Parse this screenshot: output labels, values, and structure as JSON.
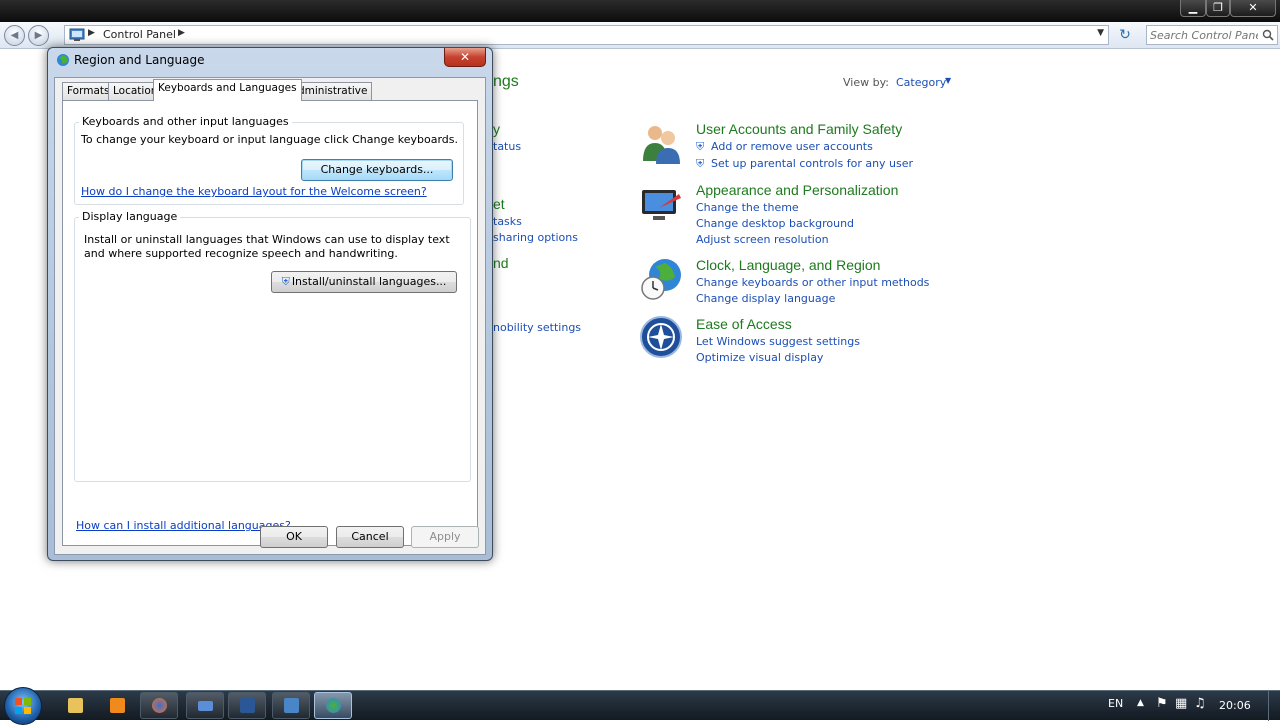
{
  "explorer": {
    "breadcrumb": "Control Panel",
    "search_placeholder": "Search Control Panel",
    "view_by_label": "View by:",
    "view_by_value": "Category",
    "partial_heading": "ngs",
    "partial_items": [
      "y",
      "tatus",
      "et",
      "tasks",
      "sharing options",
      "nd",
      "nobility settings"
    ],
    "categories": [
      {
        "title": "User Accounts and Family Safety",
        "links": [
          "Add or remove user accounts",
          "Set up parental controls for any user"
        ]
      },
      {
        "title": "Appearance and Personalization",
        "links": [
          "Change the theme",
          "Change desktop background",
          "Adjust screen resolution"
        ]
      },
      {
        "title": "Clock, Language, and Region",
        "links": [
          "Change keyboards or other input methods",
          "Change display language"
        ]
      },
      {
        "title": "Ease of Access",
        "links": [
          "Let Windows suggest settings",
          "Optimize visual display"
        ]
      }
    ]
  },
  "dialog": {
    "title": "Region and Language",
    "close_label": "✕",
    "tabs": [
      "Formats",
      "Location",
      "Keyboards and Languages",
      "Administrative"
    ],
    "active_tab": "Keyboards and Languages",
    "keyboards_group": {
      "label": "Keyboards and other input languages",
      "text": "To change your keyboard or input language click Change keyboards.",
      "button": "Change keyboards...",
      "link": "How do I change the keyboard layout for the Welcome screen?"
    },
    "display_group": {
      "label": "Display language",
      "text": "Install or uninstall languages that Windows can use to display text and where supported recognize speech and handwriting.",
      "button": "Install/uninstall languages..."
    },
    "bottom_link": "How can I install additional languages?",
    "buttons": {
      "ok": "OK",
      "cancel": "Cancel",
      "apply": "Apply"
    }
  },
  "taskbar": {
    "language": "EN",
    "clock": "20:06"
  }
}
